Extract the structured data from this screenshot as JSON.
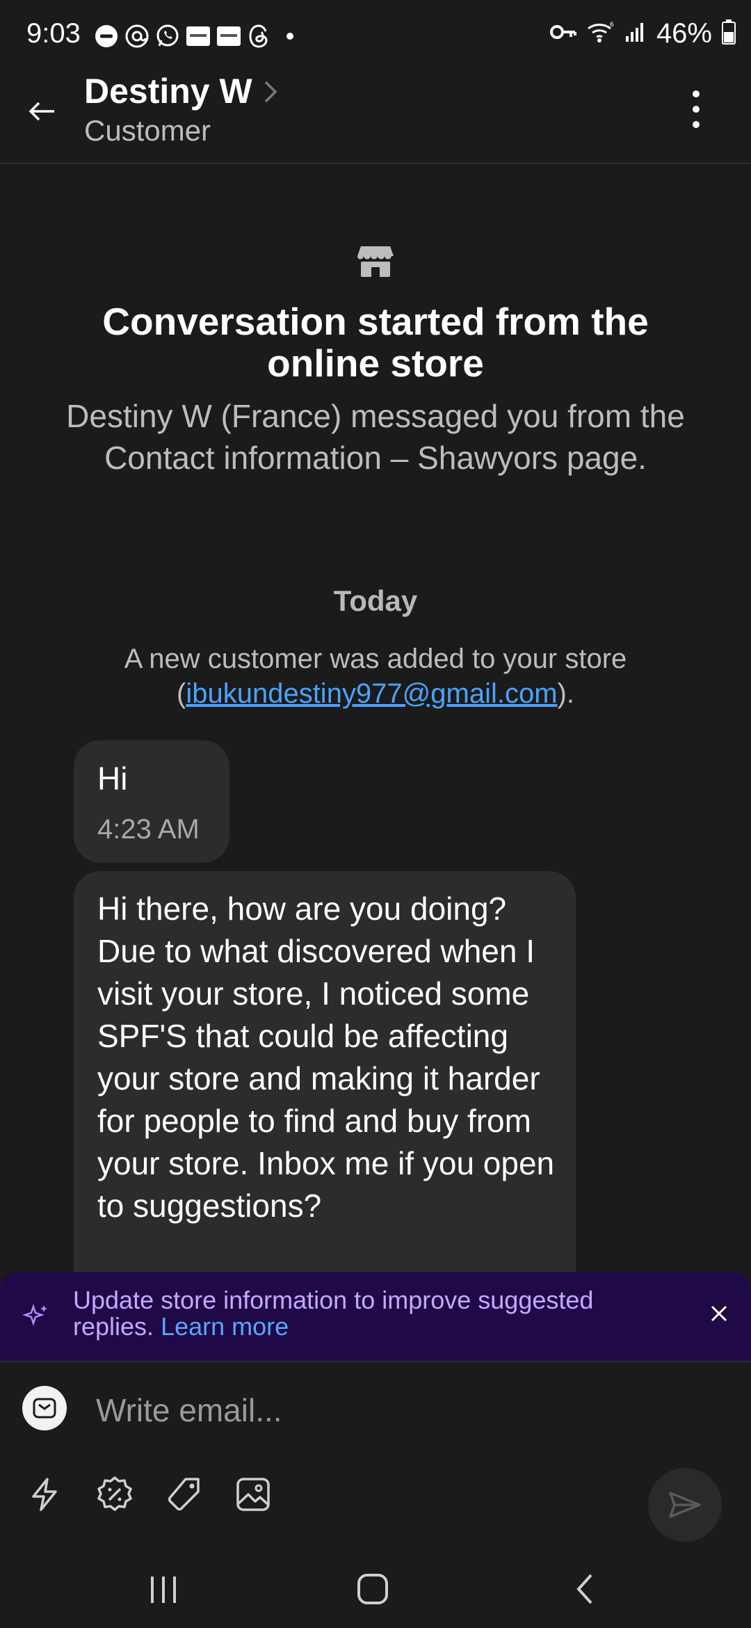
{
  "status_bar": {
    "time": "9:03",
    "battery": "46%"
  },
  "header": {
    "contact_name": "Destiny W",
    "contact_role": "Customer"
  },
  "intro": {
    "title": "Conversation started from the online store",
    "subtitle": "Destiny W (France) messaged you from the Contact information – Shawyors page."
  },
  "timeline": {
    "day_label": "Today",
    "system_prefix": "A new customer was added to your store (",
    "system_email": "ibukundestiny977@gmail.com",
    "system_suffix": ")."
  },
  "messages": [
    {
      "text": "Hi",
      "time": "4:23 AM"
    },
    {
      "text": "Hi there, how are you doing? Due to what discovered when I visit your store, I noticed some SPF'S that could be affecting your store and making it harder for people to find and buy from your store. Inbox me if you open to suggestions?"
    }
  ],
  "banner": {
    "text": "Update store information to improve suggested replies.",
    "link": "Learn more"
  },
  "composer": {
    "placeholder": "Write email..."
  },
  "colors": {
    "background": "#1b1b1b",
    "bubble": "#2c2c2c",
    "banner_bg": "#1f0a47",
    "banner_text": "#c6a8ff",
    "link": "#4aa3ff"
  }
}
